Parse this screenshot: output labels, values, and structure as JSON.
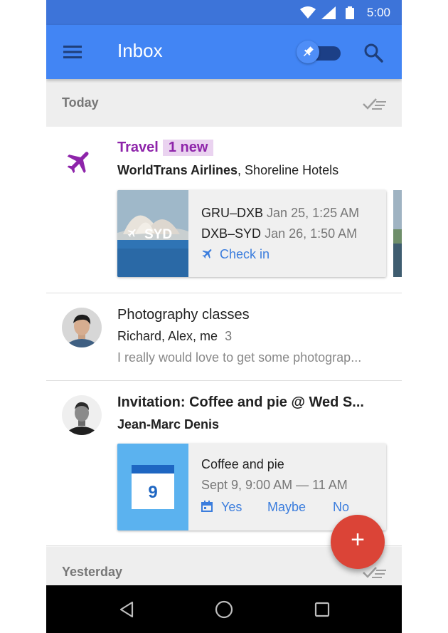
{
  "status_bar": {
    "time": "5:00"
  },
  "app_bar": {
    "title": "Inbox"
  },
  "sections": [
    {
      "label": "Today"
    },
    {
      "label": "Yesterday"
    }
  ],
  "bundle_travel": {
    "category": "Travel",
    "badge": "1 new",
    "senders_bold": "WorldTrans Airlines",
    "senders_rest": ", Shoreline Hotels",
    "image_label": "SYD",
    "flights": [
      {
        "route": "GRU–DXB",
        "time": "Jan 25, 1:25 AM"
      },
      {
        "route": "DXB–SYD",
        "time": "Jan 26, 1:50 AM"
      }
    ],
    "action": "Check in"
  },
  "thread_photo": {
    "subject": "Photography classes",
    "participants": "Richard, Alex, me",
    "count": "3",
    "snippet": "I really would love to get some photograp..."
  },
  "thread_invite": {
    "subject": "Invitation: Coffee and pie @ Wed S...",
    "sender": "Jean-Marc Denis",
    "event_title": "Coffee and pie",
    "event_time": "Sept 9, 9:00 AM — 11 AM",
    "calendar_day": "9",
    "rsvp": [
      "Yes",
      "Maybe",
      "No"
    ]
  },
  "colors": {
    "app_bar": "#4285f4",
    "status_bar": "#3d74d9",
    "travel": "#8e24aa",
    "action_blue": "#3b7ddd",
    "fab": "#db4437"
  }
}
